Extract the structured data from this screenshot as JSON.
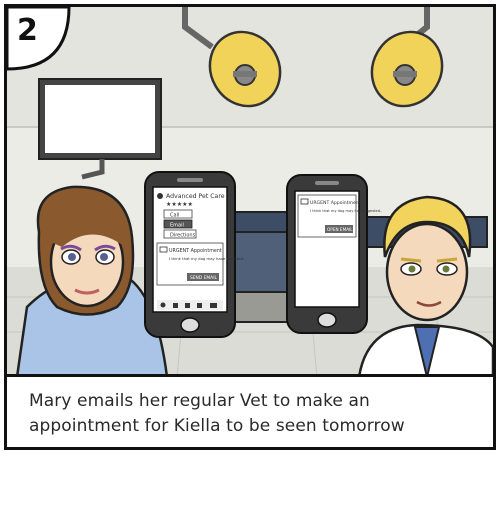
{
  "panel": {
    "number": "2",
    "caption": "Mary emails her regular Vet to make an appointment for Kiella to be seen tomorrow"
  },
  "phone_left": {
    "clinic_name": "Advanced Pet Care",
    "rating": "★★★★★",
    "actions": [
      "Call",
      "Email",
      "Directions"
    ],
    "email_subject": "URGENT Appointment",
    "email_body": "I think that my dog may have ingested..",
    "send_button": "SEND EMAIL"
  },
  "phone_right": {
    "email_subject": "URGENT Appointment",
    "email_body": "I think that my dog may have ingested..",
    "open_button": "OPEN EMAIL"
  },
  "colors": {
    "wall": "#e9e9e4",
    "lamp": "#f1d35a",
    "woman_sweater": "#a9c4e6",
    "vet_hair": "#f2d35c"
  }
}
